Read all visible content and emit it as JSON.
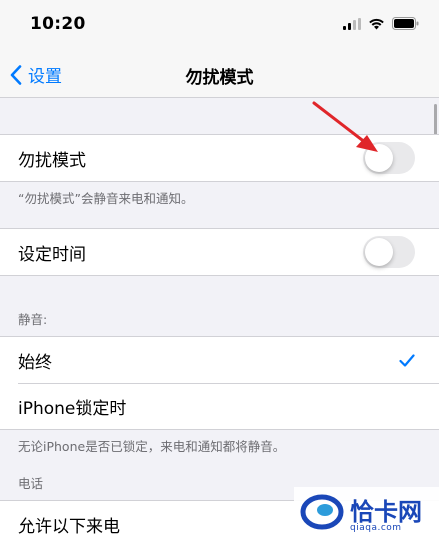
{
  "status_bar": {
    "time": "10:20"
  },
  "nav": {
    "back_label": "设置",
    "title": "勿扰模式"
  },
  "dnd_group": {
    "label": "勿扰模式",
    "enabled": false,
    "footnote": "“勿扰模式”会静音来电和通知。"
  },
  "schedule_group": {
    "label": "设定时间",
    "enabled": false
  },
  "silence_section": {
    "header": "静音:",
    "options": [
      {
        "label": "始终",
        "selected": true
      },
      {
        "label": "iPhone锁定时",
        "selected": false
      }
    ],
    "footnote": "无论iPhone是否已锁定，来电和通知都将静音。"
  },
  "phone_section": {
    "header": "电话",
    "items": [
      {
        "label": "允许以下来电"
      }
    ]
  },
  "watermark": {
    "text": "恰卡网",
    "sub": "qiaqa.com"
  },
  "colors": {
    "accent": "#007aff",
    "annotation_arrow": "#e0262a"
  }
}
